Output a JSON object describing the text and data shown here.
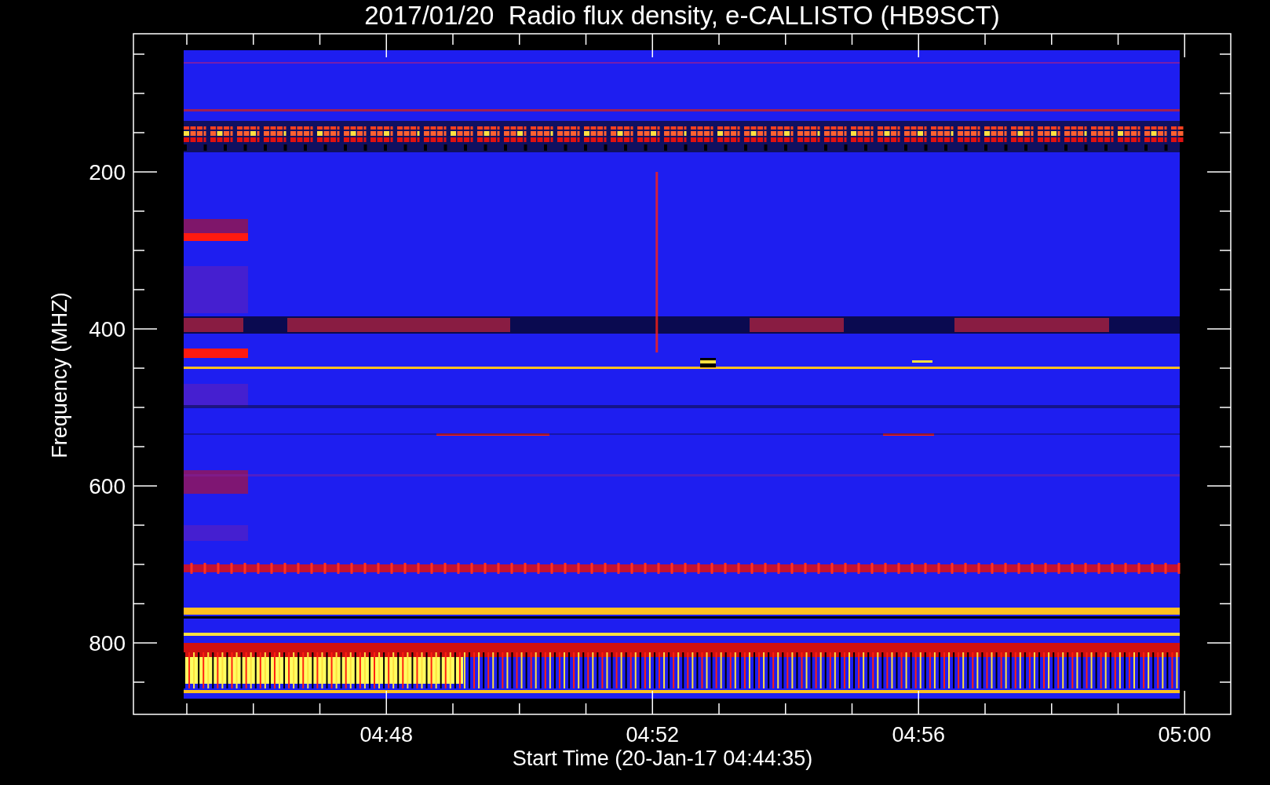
{
  "plot": {
    "title": "2017/01/20  Radio flux density, e-CALLISTO (HB9SCT)",
    "xlabel": "Start Time (20-Jan-17 04:44:35)",
    "ylabel": "Frequency (MHZ)",
    "x_tick_labels": [
      "04:48",
      "04:52",
      "04:56",
      "05:00"
    ],
    "y_tick_labels": [
      "200",
      "400",
      "600",
      "800"
    ]
  }
}
